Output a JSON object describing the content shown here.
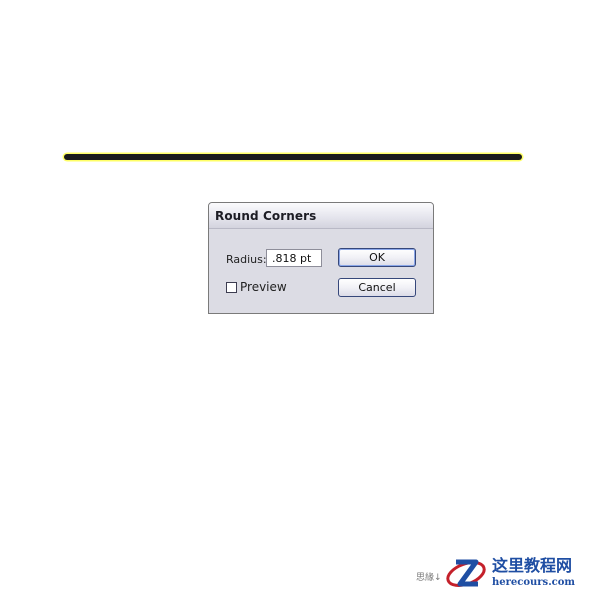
{
  "dialog": {
    "title": "Round Corners",
    "radius_label": "Radius:",
    "radius_value": ".818 pt",
    "preview_label": "Preview",
    "preview_checked": false,
    "ok_label": "OK",
    "cancel_label": "Cancel"
  },
  "artboard": {
    "line_stroke_color": "#1a1a1a",
    "line_highlight_color": "#ffff66"
  },
  "watermark": {
    "small_text": "思緣↓",
    "site_name_cn": "这里教程网",
    "site_name_en": "herecours.com",
    "logo_icon": "z-logo-icon",
    "logo_colors": [
      "#c4202a",
      "#1f4ea3"
    ]
  }
}
